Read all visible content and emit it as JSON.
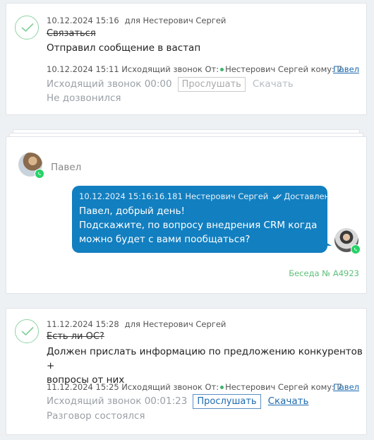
{
  "activities": [
    {
      "date": "10.12.2024 15:16",
      "for_text": "для Нестерович Сергей",
      "subject": "Связаться",
      "body": "Отправил сообщение в вастап",
      "call": {
        "meta_left": "10.12.2024 15:11 Исходящий звонок От:",
        "from_name": "Нестерович Сергей кому: 7",
        "to_link": "Павел",
        "label": "Исходящий звонок 00:00",
        "listen_label": "Прослушать",
        "download_label": "Скачать",
        "status": "Не дозвонился"
      }
    },
    {
      "date": "11.12.2024 15:28",
      "for_text": "для Нестерович Сергей",
      "subject": "Есть ли ОС?",
      "body_line1": "Должен прислать информацию по предложению конкурентов +",
      "body_line2": "вопросы от них",
      "call": {
        "meta_left": "11.12.2024 15:25 Исходящий звонок От:",
        "from_name": "Нестерович Сергей кому: 7",
        "to_link": "Павел",
        "label": "Исходящий звонок 00:01:23",
        "listen_label": "Прослушать",
        "download_label": "Скачать",
        "status": "Разговор состоялся"
      }
    }
  ],
  "chat": {
    "contact_name": "Павел",
    "message": {
      "meta": "10.12.2024 15:16:16.181 Нестерович Сергей",
      "status": "Доставлен",
      "line1": "Павел, добрый день!",
      "line2": "Подскажите, по вопросу внедрения CRM когда",
      "line3": "можно будет с вами пообщаться?"
    },
    "conversation_link": "Беседа № A4923"
  },
  "colors": {
    "accent_blue": "#127fc0",
    "link_blue": "#1e6bb0",
    "success_green": "#3cb371",
    "whatsapp_green": "#25d366"
  }
}
